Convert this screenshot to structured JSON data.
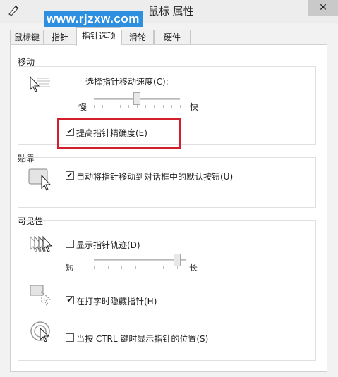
{
  "window": {
    "title": "鼠标 属性",
    "watermark": "www.rjzxw.com",
    "close_glyph": "✕"
  },
  "tabs": [
    {
      "label": "鼠标键",
      "active": false
    },
    {
      "label": "指针",
      "active": false
    },
    {
      "label": "指针选项",
      "active": true
    },
    {
      "label": "滑轮",
      "active": false
    },
    {
      "label": "硬件",
      "active": false
    }
  ],
  "motion": {
    "group_label": "移动",
    "speed_label": "选择指针移动速度(C):",
    "slow_label": "慢",
    "fast_label": "快",
    "speed_value": 0.5,
    "precision_label": "提高指针精确度(E)",
    "precision_checked": true,
    "icon": "pointer-speed-icon"
  },
  "snap": {
    "group_label": "贴靠",
    "snap_label": "自动将指针移动到对话框中的默认按钮(U)",
    "snap_checked": true,
    "icon": "snap-to-button-icon"
  },
  "visibility": {
    "group_label": "可见性",
    "trails_label": "显示指针轨迹(D)",
    "trails_checked": false,
    "short_label": "短",
    "long_label": "长",
    "trails_value": 1.0,
    "hide_label": "在打字时隐藏指针(H)",
    "hide_checked": true,
    "ctrl_label": "当按 CTRL 键时显示指针的位置(S)",
    "ctrl_checked": false,
    "icons": [
      "pointer-trails-icon",
      "hide-pointer-icon",
      "pointer-location-icon"
    ]
  },
  "colors": {
    "highlight": "#d21f2b",
    "watermark_bg": "#2c8fe0"
  }
}
